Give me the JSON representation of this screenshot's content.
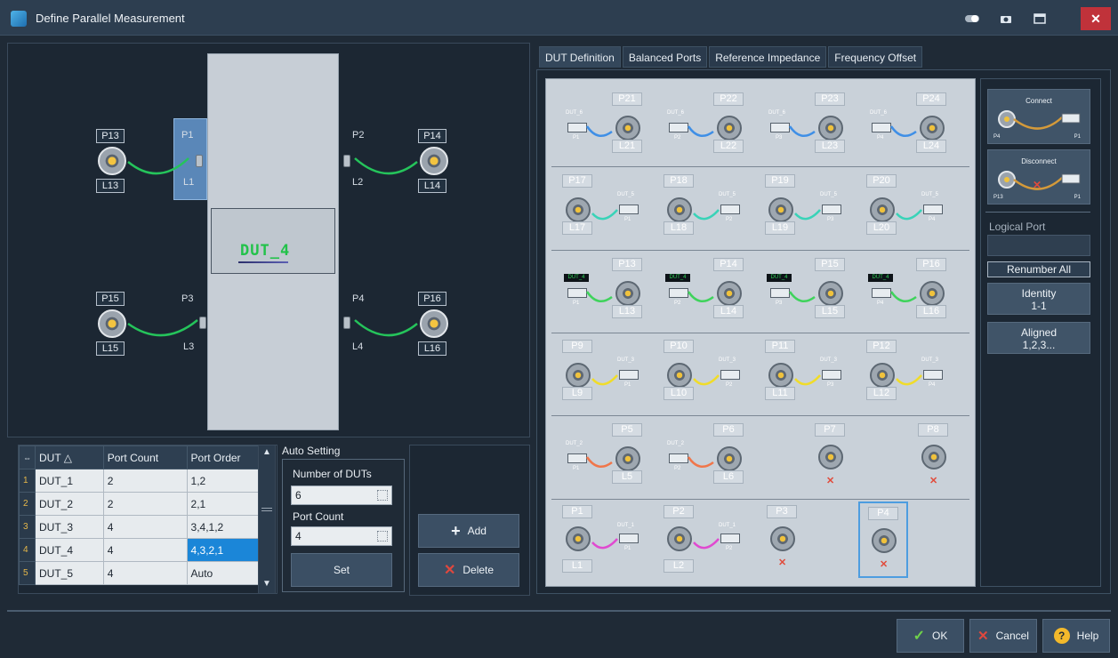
{
  "window": {
    "title": "Define Parallel Measurement"
  },
  "diagram": {
    "dut_label": "DUT_4",
    "ports": [
      {
        "box_top": "P13",
        "box_bottom": "L13",
        "phys": "P1",
        "log": "L1"
      },
      {
        "box_top": "P14",
        "box_bottom": "L14",
        "phys": "P2",
        "log": "L2"
      },
      {
        "box_top": "P15",
        "box_bottom": "L15",
        "phys": "P3",
        "log": "L3"
      },
      {
        "box_top": "P16",
        "box_bottom": "L16",
        "phys": "P4",
        "log": "L4"
      }
    ]
  },
  "table": {
    "headers": {
      "dut": "DUT",
      "port_count": "Port Count",
      "port_order": "Port Order"
    },
    "rows": [
      {
        "idx": "1",
        "dut": "DUT_1",
        "count": "2",
        "order": "1,2"
      },
      {
        "idx": "2",
        "dut": "DUT_2",
        "count": "2",
        "order": "2,1"
      },
      {
        "idx": "3",
        "dut": "DUT_3",
        "count": "4",
        "order": "3,4,1,2"
      },
      {
        "idx": "4",
        "dut": "DUT_4",
        "count": "4",
        "order": "4,3,2,1"
      },
      {
        "idx": "5",
        "dut": "DUT_5",
        "count": "4",
        "order": "Auto"
      }
    ]
  },
  "auto_setting": {
    "heading": "Auto Setting",
    "num_duts_label": "Number of DUTs",
    "num_duts_value": "6",
    "port_count_label": "Port Count",
    "port_count_value": "4",
    "set_label": "Set"
  },
  "actions": {
    "add": "Add",
    "delete": "Delete"
  },
  "tabs": [
    "DUT Definition",
    "Balanced Ports",
    "Reference Impedance",
    "Frequency Offset"
  ],
  "grid": {
    "row1": [
      {
        "p": "P21",
        "l": "L21",
        "dut": "DUT_6",
        "port": "P1"
      },
      {
        "p": "P22",
        "l": "L22",
        "dut": "DUT_6",
        "port": "P2"
      },
      {
        "p": "P23",
        "l": "L23",
        "dut": "DUT_6",
        "port": "P3"
      },
      {
        "p": "P24",
        "l": "L24",
        "dut": "DUT_6",
        "port": "P4"
      }
    ],
    "row2": [
      {
        "p": "P17",
        "l": "L17",
        "dut": "DUT_5",
        "port": "P1"
      },
      {
        "p": "P18",
        "l": "L18",
        "dut": "DUT_5",
        "port": "P2"
      },
      {
        "p": "P19",
        "l": "L19",
        "dut": "DUT_5",
        "port": "P3"
      },
      {
        "p": "P20",
        "l": "L20",
        "dut": "DUT_5",
        "port": "P4"
      }
    ],
    "row3": [
      {
        "p": "P13",
        "l": "L13",
        "dut": "DUT_4",
        "port": "P1"
      },
      {
        "p": "P14",
        "l": "L14",
        "dut": "DUT_4",
        "port": "P2"
      },
      {
        "p": "P15",
        "l": "L15",
        "dut": "DUT_4",
        "port": "P3"
      },
      {
        "p": "P16",
        "l": "L16",
        "dut": "DUT_4",
        "port": "P4"
      }
    ],
    "row4": [
      {
        "p": "P9",
        "l": "L9",
        "dut": "DUT_3",
        "port": "P1"
      },
      {
        "p": "P10",
        "l": "L10",
        "dut": "DUT_3",
        "port": "P2"
      },
      {
        "p": "P11",
        "l": "L11",
        "dut": "DUT_3",
        "port": "P3"
      },
      {
        "p": "P12",
        "l": "L12",
        "dut": "DUT_3",
        "port": "P4"
      }
    ],
    "row5": [
      {
        "p": "P5",
        "l": "L5",
        "dut": "DUT_2",
        "port": "P1"
      },
      {
        "p": "P6",
        "l": "L6",
        "dut": "DUT_2",
        "port": "P2"
      },
      {
        "p": "P7",
        "l": "",
        "dut": "",
        "port": ""
      },
      {
        "p": "P8",
        "l": "",
        "dut": "",
        "port": ""
      }
    ],
    "row6": [
      {
        "p": "P1",
        "l": "L1",
        "dut": "DUT_1",
        "port": "P1"
      },
      {
        "p": "P2",
        "l": "L2",
        "dut": "DUT_1",
        "port": "P2"
      },
      {
        "p": "P3",
        "l": "",
        "dut": "",
        "port": ""
      },
      {
        "p": "P4",
        "l": "",
        "dut": "",
        "port": ""
      }
    ]
  },
  "side": {
    "connect": "Connect",
    "connect_left": "P4",
    "connect_right": "P1",
    "disconnect": "Disconnect",
    "disconnect_left": "P13",
    "disconnect_right": "P1",
    "logical_port": "Logical Port",
    "renumber_all": "Renumber All",
    "identity": "Identity",
    "identity_sub": "1-1",
    "aligned": "Aligned",
    "aligned_sub": "1,2,3..."
  },
  "footer": {
    "ok": "OK",
    "cancel": "Cancel",
    "help": "Help"
  },
  "colors": {
    "accent": "#1b86d8",
    "dut_green": "#22c24a",
    "close_red": "#c0323a"
  }
}
